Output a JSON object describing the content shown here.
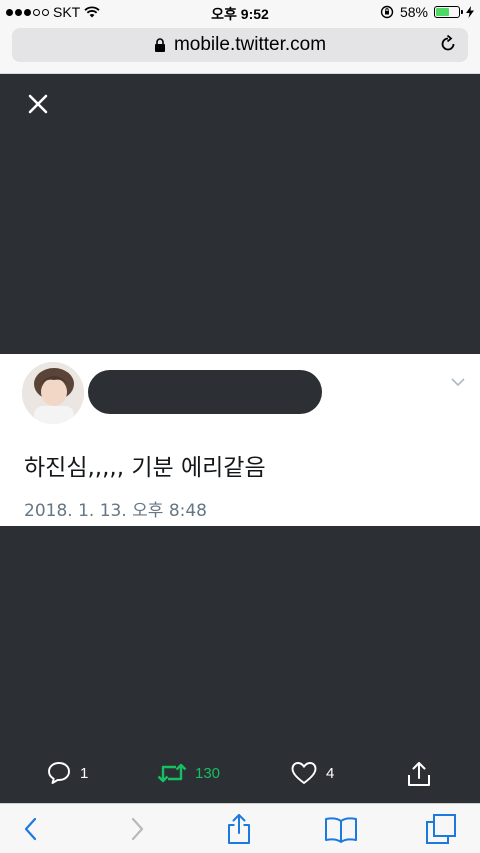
{
  "status_bar": {
    "carrier": "SKT",
    "time": "오후 9:52",
    "battery": "58%",
    "battery_level": 0.58
  },
  "browser": {
    "url": "mobile.twitter.com"
  },
  "tweet": {
    "text": "하진심,,,,, 기분 에리같음",
    "timestamp": "2018. 1. 13. 오후 8:48"
  },
  "actions": {
    "reply_count": "1",
    "retweet_count": "130",
    "like_count": "4"
  },
  "colors": {
    "retweet_green": "#17bf63",
    "toolbar_blue": "#1a7ae0",
    "media_bg": "#2c2f33"
  },
  "icons": [
    "wifi-icon",
    "lock-icon",
    "reload-icon",
    "close-icon",
    "chevron-down-icon",
    "reply-icon",
    "retweet-icon",
    "like-icon",
    "share-icon",
    "back-icon",
    "forward-icon",
    "bookmarks-icon",
    "tabs-icon"
  ]
}
